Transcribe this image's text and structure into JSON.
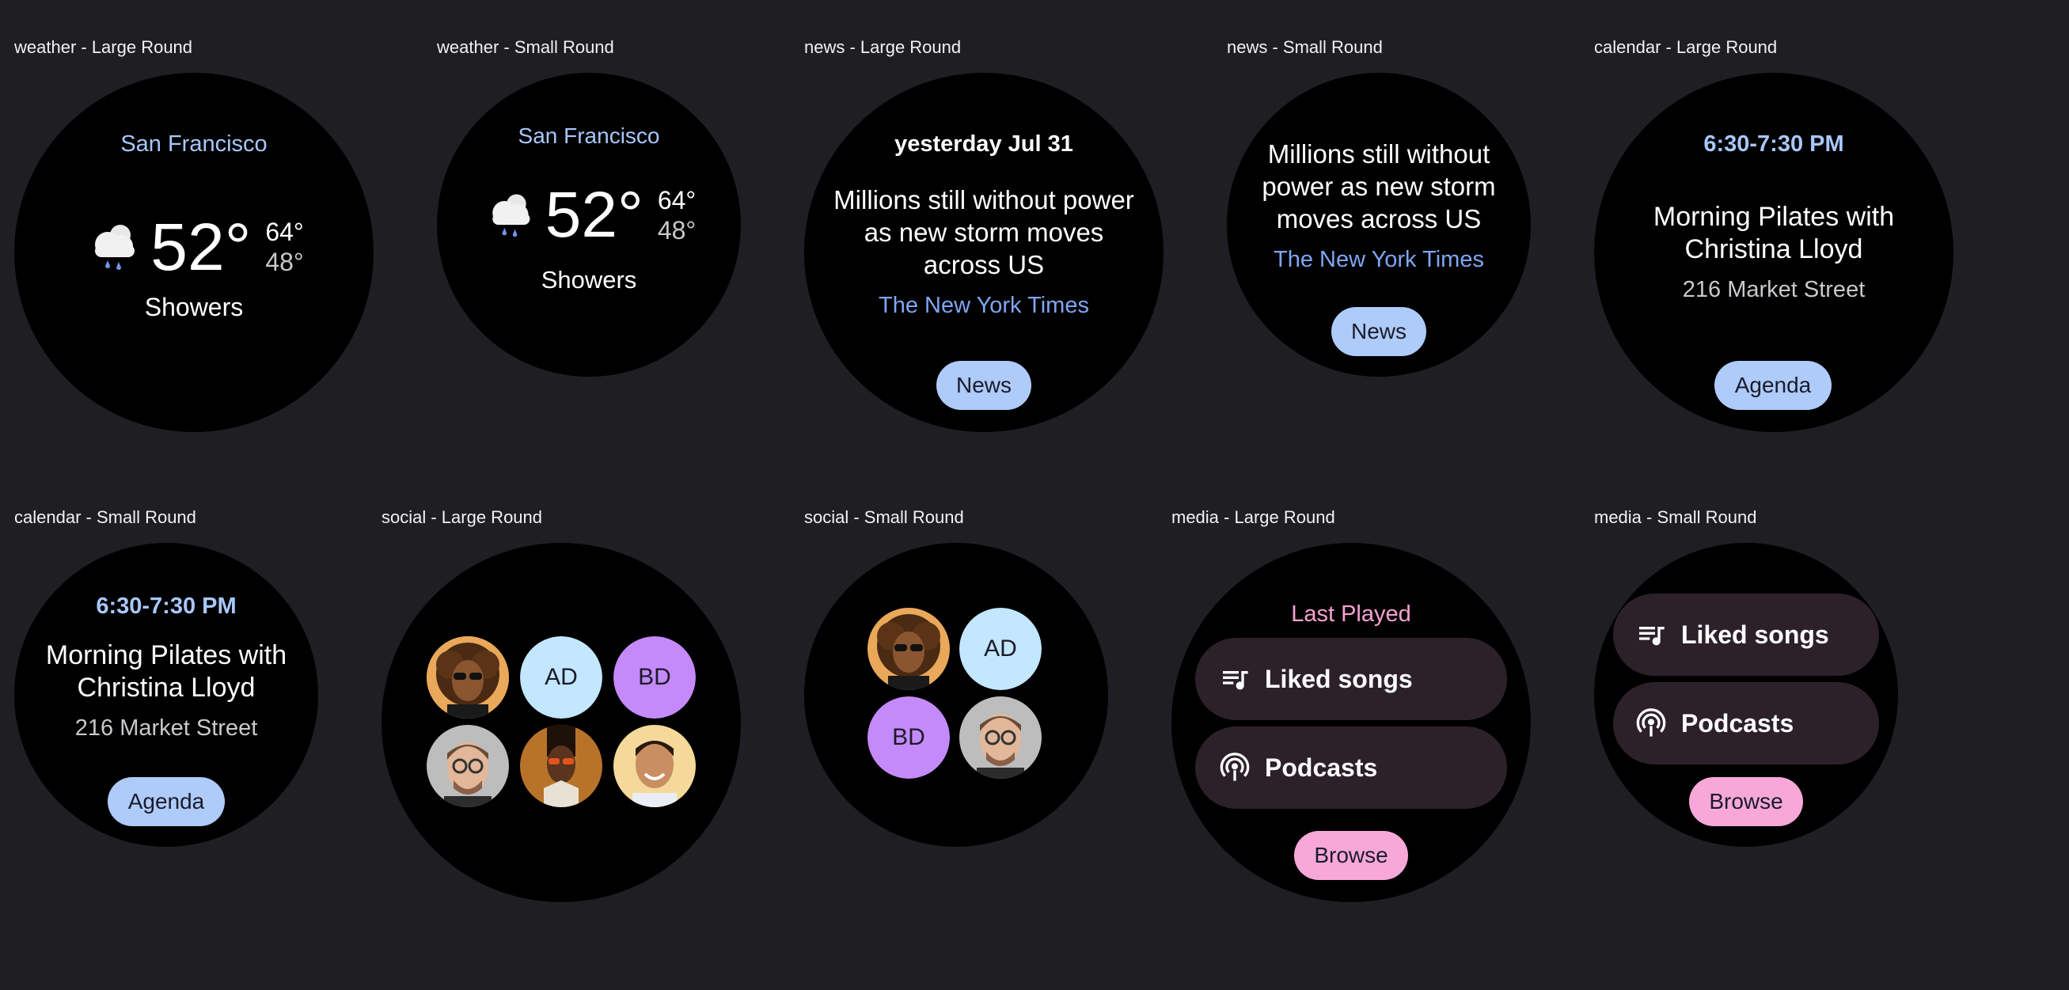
{
  "colors": {
    "background": "#1f1f23",
    "dial": "#000000",
    "accent_blue": "#aecbfa",
    "accent_pink": "#f8a8d8",
    "chip": "#2d2129"
  },
  "captions": {
    "weather_large": "weather - Large Round",
    "weather_small": "weather - Small Round",
    "news_large": "news - Large Round",
    "news_small": "news - Small Round",
    "calendar_large": "calendar - Large Round",
    "calendar_small": "calendar - Small Round",
    "social_large": "social - Large Round",
    "social_small": "social - Small Round",
    "media_large": "media - Large Round",
    "media_small": "media - Small Round"
  },
  "weather": {
    "location": "San Francisco",
    "temp": "52°",
    "high": "64°",
    "low": "48°",
    "condition": "Showers",
    "icon": "showers-icon"
  },
  "news": {
    "date": "yesterday Jul 31",
    "headline_lines": [
      "Millions still without power",
      "as new storm moves",
      "across US"
    ],
    "headline_small_lines": [
      "Millions still without",
      "power as new storm",
      "moves across US"
    ],
    "source": "The New York Times",
    "button": "News"
  },
  "calendar": {
    "time": "6:30-7:30 PM",
    "title_lines": [
      "Morning Pilates with",
      "Christina Lloyd"
    ],
    "location": "216 Market Street",
    "button": "Agenda"
  },
  "social": {
    "contacts": [
      {
        "type": "photo",
        "icon": "avatar-curly-hair-sunglasses"
      },
      {
        "type": "initials",
        "text": "AD",
        "color": "#c2e7ff"
      },
      {
        "type": "initials",
        "text": "BD",
        "color": "#c58af9"
      },
      {
        "type": "photo",
        "icon": "avatar-man-glasses"
      },
      {
        "type": "photo",
        "icon": "avatar-woman-orange-sunglasses"
      },
      {
        "type": "photo",
        "icon": "avatar-man-smiling"
      }
    ]
  },
  "media": {
    "header": "Last Played",
    "items": [
      {
        "label": "Liked songs",
        "icon": "playlist-icon"
      },
      {
        "label": "Podcasts",
        "icon": "podcast-icon"
      }
    ],
    "button": "Browse"
  }
}
